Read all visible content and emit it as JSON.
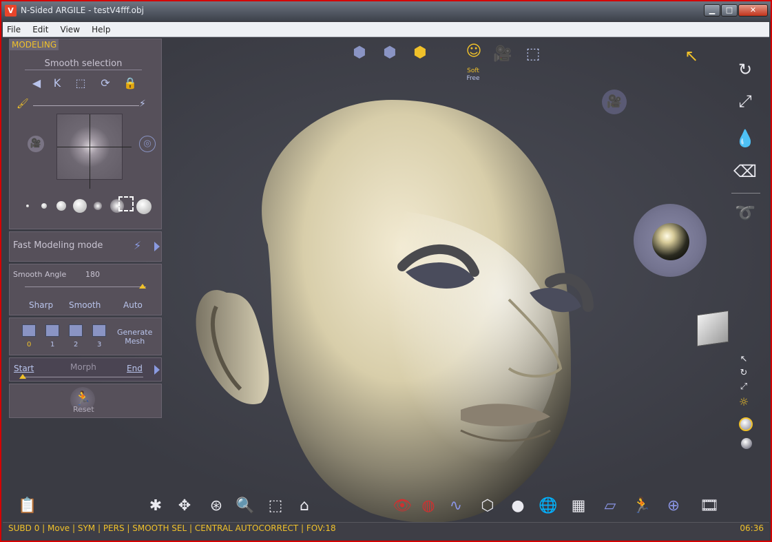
{
  "window": {
    "title": "N-Sided ARGILE - testV4fff.obj",
    "minimize": "▁",
    "maximize": "□",
    "close": "✕"
  },
  "menu": [
    "File",
    "Edit",
    "View",
    "Help"
  ],
  "left_panel": {
    "tab": "MODELING",
    "smooth_selection": "Smooth selection",
    "fast_modeling": "Fast Modeling mode",
    "smooth_angle_label": "Smooth Angle",
    "smooth_angle_value": "180",
    "angle_options": [
      "Sharp",
      "Smooth",
      "Auto"
    ],
    "subdivision_levels": [
      "0",
      "1",
      "2",
      "3"
    ],
    "generate_mesh_line1": "Generate",
    "generate_mesh_line2": "Mesh",
    "morph_start": "Start",
    "morph_label": "Morph",
    "morph_end": "End",
    "reset": "Reset"
  },
  "top_toolbar": {
    "soft_free_line1": "Soft",
    "soft_free_line2": "Free"
  },
  "status_bar": {
    "text": "SUBD 0 | Move | SYM | PERS | SMOOTH SEL | CENTRAL AUTOCORRECT | FOV:18",
    "time": "06:36"
  },
  "colors": {
    "accent": "#f0c12a",
    "panel_bg": "#56505a",
    "viewport_bg": "#3c3c44",
    "icon_blue": "#b9c4ec"
  }
}
